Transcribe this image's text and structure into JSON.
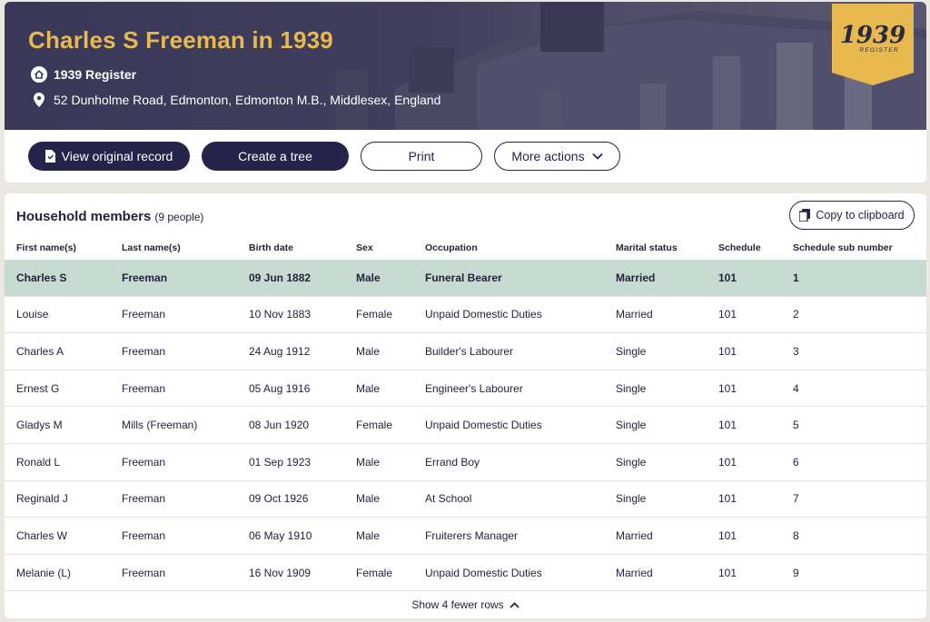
{
  "hero": {
    "title": "Charles S Freeman in 1939",
    "record_type": "1939 Register",
    "address": "52 Dunholme Road, Edmonton, Edmonton M.B., Middlesex, England",
    "badge_year": "1939",
    "badge_sub": "REGISTER"
  },
  "actions": {
    "view_original": "View original record",
    "create_tree": "Create a tree",
    "print": "Print",
    "more_actions": "More actions"
  },
  "household": {
    "title": "Household members",
    "count": "(9 people)",
    "copy_label": "Copy to clipboard",
    "columns": [
      "First name(s)",
      "Last name(s)",
      "Birth date",
      "Sex",
      "Occupation",
      "Marital status",
      "Schedule",
      "Schedule sub number"
    ],
    "rows": [
      [
        "Charles S",
        "Freeman",
        "09 Jun 1882",
        "Male",
        "Funeral Bearer",
        "Married",
        "101",
        "1"
      ],
      [
        "Louise",
        "Freeman",
        "10 Nov 1883",
        "Female",
        "Unpaid Domestic Duties",
        "Married",
        "101",
        "2"
      ],
      [
        "Charles A",
        "Freeman",
        "24 Aug 1912",
        "Male",
        "Builder's Labourer",
        "Single",
        "101",
        "3"
      ],
      [
        "Ernest G",
        "Freeman",
        "05 Aug 1916",
        "Male",
        "Engineer's Labourer",
        "Single",
        "101",
        "4"
      ],
      [
        "Gladys M",
        "Mills (Freeman)",
        "08 Jun 1920",
        "Female",
        "Unpaid Domestic Duties",
        "Single",
        "101",
        "5"
      ],
      [
        "Ronald L",
        "Freeman",
        "01 Sep 1923",
        "Male",
        "Errand Boy",
        "Single",
        "101",
        "6"
      ],
      [
        "Reginald J",
        "Freeman",
        "09 Oct 1926",
        "Male",
        "At School",
        "Single",
        "101",
        "7"
      ],
      [
        "Charles W",
        "Freeman",
        "06 May 1910",
        "Male",
        "Fruiterers Manager",
        "Married",
        "101",
        "8"
      ],
      [
        "Melanie (L)",
        "Freeman",
        "16 Nov 1909",
        "Female",
        "Unpaid Domestic Duties",
        "Married",
        "101",
        "9"
      ]
    ],
    "toggle_label": "Show 4 fewer rows"
  },
  "colors": {
    "navy": "#25234a",
    "gold": "#e8b94e",
    "highlight": "#c8dbd3",
    "page_bg": "#ebe8e3"
  },
  "icons": {
    "record_type": "house-icon",
    "address": "location-pin-icon",
    "view_original": "document-icon",
    "more_actions": "chevron-down-icon",
    "copy": "copy-icon",
    "toggle": "chevron-up-icon"
  }
}
